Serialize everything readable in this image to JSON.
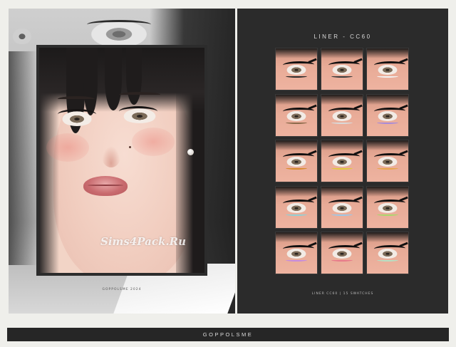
{
  "left_panel": {
    "watermark": "Sims4Pack.Ru",
    "caption": "GOPPOLSME 2024"
  },
  "right_panel": {
    "title": "LINER - CC60",
    "caption": "LINER CC60 | 15 SWATCHES",
    "swatches": [
      {
        "id": 1,
        "accent": "#2a2a2a"
      },
      {
        "id": 2,
        "accent": "#3a3a3a"
      },
      {
        "id": 3,
        "accent": "#f2f2f2"
      },
      {
        "id": 4,
        "accent": "#8b6a4a"
      },
      {
        "id": 5,
        "accent": "#d9d9d9"
      },
      {
        "id": 6,
        "accent": "#a88bd9"
      },
      {
        "id": 7,
        "accent": "#d98a2b"
      },
      {
        "id": 8,
        "accent": "#e3c93a"
      },
      {
        "id": 9,
        "accent": "#e8a54a"
      },
      {
        "id": 10,
        "accent": "#8fd0d6"
      },
      {
        "id": 11,
        "accent": "#9cc7e8"
      },
      {
        "id": 12,
        "accent": "#a9d86b"
      },
      {
        "id": 13,
        "accent": "#c58be0"
      },
      {
        "id": 14,
        "accent": "#e87a8a"
      },
      {
        "id": 15,
        "accent": "#b5e0c4"
      }
    ]
  },
  "footer": {
    "brand": "GOPPOLSME"
  },
  "colors": {
    "page_bg": "#efefeb",
    "dark_panel": "#2b2b2b",
    "footer_bar": "#262626"
  }
}
